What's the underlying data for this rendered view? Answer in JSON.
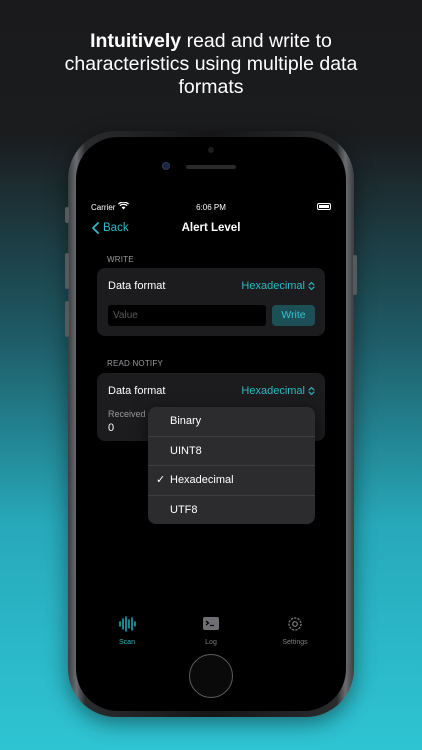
{
  "headline": {
    "bold": "Intuitively",
    "line1_rest": " read and write to",
    "line2": "characteristics using multiple data",
    "line3": "formats"
  },
  "status_bar": {
    "carrier": "Carrier",
    "time": "6:06 PM"
  },
  "nav": {
    "back_label": "Back",
    "title": "Alert Level"
  },
  "write_section": {
    "header": "WRITE",
    "data_format_label": "Data format",
    "data_format_value": "Hexadecimal",
    "value_placeholder": "Value",
    "write_button": "Write"
  },
  "read_section": {
    "header": "READ NOTIFY",
    "data_format_label": "Data format",
    "data_format_value": "Hexadecimal",
    "received_label": "Received",
    "received_value": "0"
  },
  "format_menu": {
    "options": [
      "Binary",
      "UINT8",
      "Hexadecimal",
      "UTF8"
    ],
    "selected": "Hexadecimal",
    "check_glyph": "✓"
  },
  "tabbar": {
    "tabs": [
      {
        "label": "Scan",
        "icon": "waveform-icon",
        "active": true
      },
      {
        "label": "Log",
        "icon": "terminal-icon",
        "active": false
      },
      {
        "label": "Settings",
        "icon": "gear-icon",
        "active": false
      }
    ]
  },
  "colors": {
    "accent": "#2fb8c6",
    "card_background": "#1c1c1e",
    "menu_background": "#2c2c2e",
    "screen_background": "#000000"
  }
}
